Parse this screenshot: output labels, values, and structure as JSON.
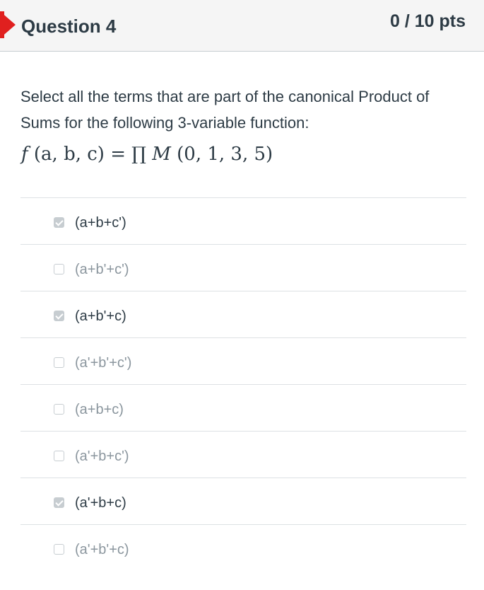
{
  "question": {
    "title": "Question 4",
    "points": "0 / 10 pts",
    "flag_color": "#e0201f",
    "prompt": "Select all the terms that are part of the canonical Product of Sums for the following 3-variable function:",
    "formula_lhs": "f",
    "formula_args": "(a, b, c)",
    "formula_eq": "=",
    "formula_prod": "∏",
    "formula_M": "M",
    "formula_set": "(0, 1, 3, 5)"
  },
  "answers": [
    {
      "label": "(a+b+c')",
      "checked": true
    },
    {
      "label": "(a+b'+c')",
      "checked": false
    },
    {
      "label": "(a+b'+c)",
      "checked": true
    },
    {
      "label": "(a'+b'+c')",
      "checked": false
    },
    {
      "label": "(a+b+c)",
      "checked": false
    },
    {
      "label": "(a'+b+c')",
      "checked": false
    },
    {
      "label": "(a'+b+c)",
      "checked": true
    },
    {
      "label": "(a'+b'+c)",
      "checked": false
    }
  ]
}
